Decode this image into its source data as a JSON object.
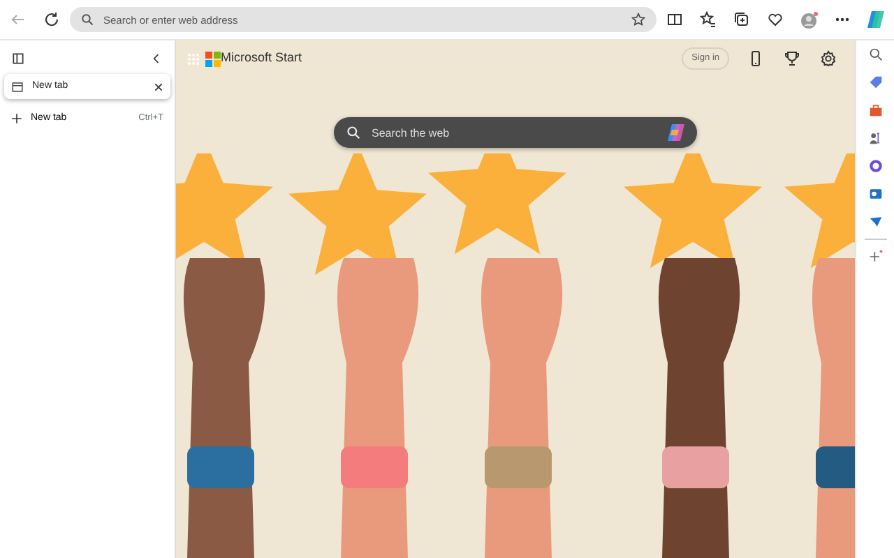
{
  "address_bar": {
    "placeholder": "Search or enter web address"
  },
  "vertical_tabs": {
    "tabs": [
      {
        "label": "New tab",
        "selected": true
      }
    ],
    "new_tab": {
      "label": "New tab",
      "shortcut": "Ctrl+T"
    }
  },
  "page": {
    "brand": "Microsoft Start",
    "sign_in": "Sign in",
    "search": {
      "placeholder": "Search the web"
    }
  }
}
